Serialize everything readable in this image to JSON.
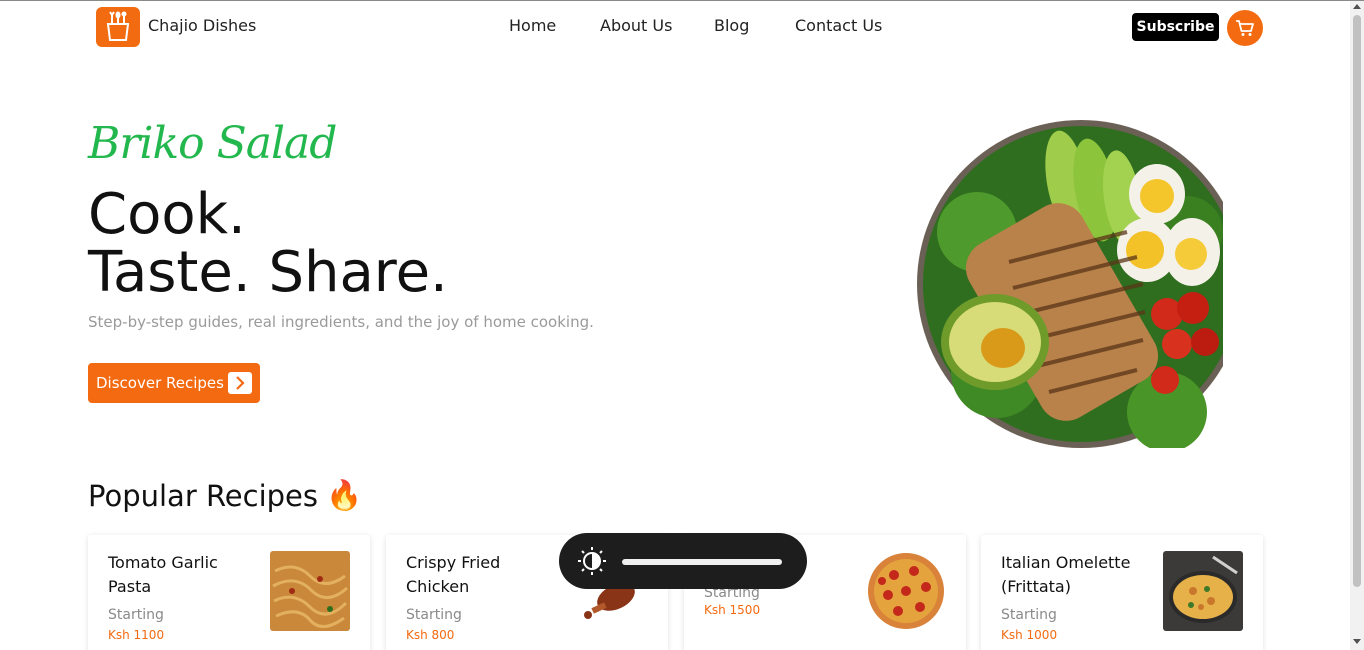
{
  "header": {
    "brand": "Chajio Dishes",
    "nav": [
      "Home",
      "About Us",
      "Blog",
      "Contact Us"
    ],
    "subscribe_label": "Subscribe",
    "icons": {
      "logo": "chef-pot-logo",
      "cart": "cart-icon"
    }
  },
  "hero": {
    "script_title": "Briko Salad",
    "heading_line1": "Cook.",
    "heading_line2": "Taste. Share.",
    "tagline": "Step-by-step guides, real ingredients, and the joy of home cooking.",
    "cta_label": "Discover Recipes",
    "image": "salad-bowl-image"
  },
  "popular": {
    "title": "Popular Recipes",
    "emoji": "🔥",
    "recipes": [
      {
        "title": "Tomato Garlic Pasta",
        "starting": "Starting",
        "price": "Ksh 1100",
        "image": "pasta-thumbnail"
      },
      {
        "title": "Crispy Fried Chicken",
        "starting": "Starting",
        "price": "Ksh 800",
        "image": "fried-chicken-thumbnail"
      },
      {
        "title": "",
        "starting": "Starting",
        "price": "Ksh 1500",
        "image": "pizza-thumbnail"
      },
      {
        "title": "Italian Omelette (Frittata)",
        "starting": "Starting",
        "price": "Ksh 1000",
        "image": "frittata-thumbnail"
      }
    ]
  },
  "brightness_overlay": {
    "icon": "brightness-icon",
    "level": 1.0
  },
  "colors": {
    "accent": "#f46a10",
    "script_green": "#22b84d",
    "dark": "#000000"
  }
}
